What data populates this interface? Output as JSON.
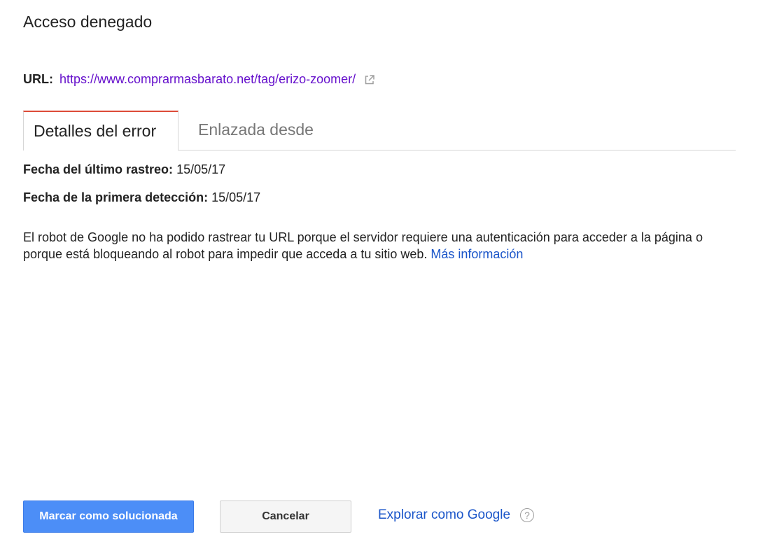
{
  "dialog": {
    "title": "Acceso denegado"
  },
  "url": {
    "label": "URL:",
    "value": "https://www.comprarmasbarato.net/tag/erizo-zoomer/",
    "icon": "external-link-icon"
  },
  "tabs": [
    {
      "label": "Detalles del error",
      "active": true
    },
    {
      "label": "Enlazada desde",
      "active": false
    }
  ],
  "details": {
    "last_crawl_label": "Fecha del último rastreo:",
    "last_crawl_value": "15/05/17",
    "first_detected_label": "Fecha de la primera detección:",
    "first_detected_value": "15/05/17"
  },
  "description": {
    "text": "El robot de Google no ha podido rastrear tu URL porque el servidor requiere una autenticación para acceder a la página o porque está bloqueando al robot para impedir que acceda a tu sitio web.",
    "link": "Más información"
  },
  "actions": {
    "mark_fixed": "Marcar como solucionada",
    "cancel": "Cancelar",
    "fetch_as_google": "Explorar como Google",
    "help_glyph": "?"
  },
  "colors": {
    "primary_button": "#4c8ef7",
    "active_tab_accent": "#dd4b39",
    "link": "#1a55c9",
    "url_link": "#6611cc"
  }
}
